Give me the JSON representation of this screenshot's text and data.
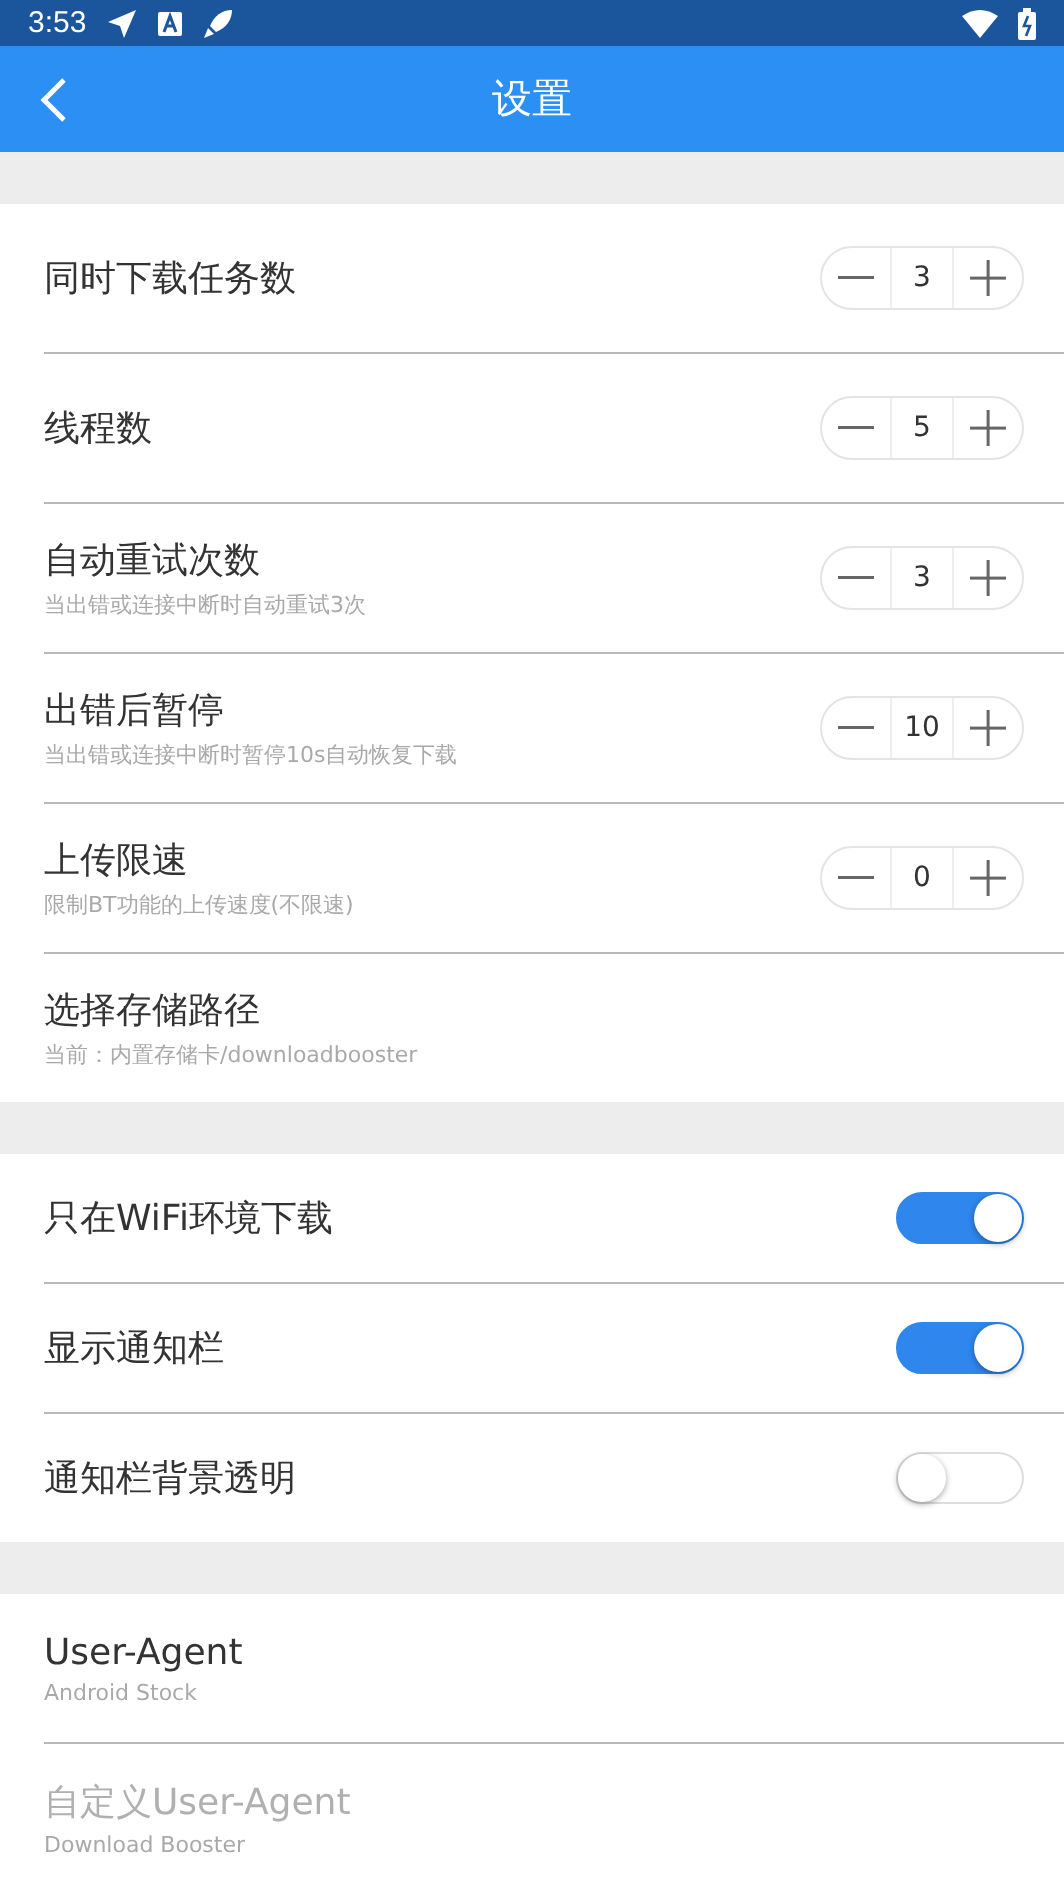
{
  "status_bar": {
    "time": "3:53"
  },
  "app_bar": {
    "title": "设置"
  },
  "sections": [
    {
      "rows": [
        {
          "kind": "stepper",
          "title": "同时下载任务数",
          "value": "3",
          "disabled": false
        },
        {
          "kind": "stepper",
          "title": "线程数",
          "value": "5",
          "disabled": false
        },
        {
          "kind": "stepper",
          "title": "自动重试次数",
          "subtitle": "当出错或连接中断时自动重试3次",
          "value": "3",
          "disabled": false
        },
        {
          "kind": "stepper",
          "title": "出错后暂停",
          "subtitle": "当出错或连接中断时暂停10s自动恢复下载",
          "value": "10",
          "disabled": false
        },
        {
          "kind": "stepper",
          "title": "上传限速",
          "subtitle": "限制BT功能的上传速度(不限速)",
          "value": "0",
          "disabled": false
        },
        {
          "kind": "link",
          "title": "选择存储路径",
          "subtitle": "当前：内置存储卡/downloadbooster",
          "disabled": false
        }
      ]
    },
    {
      "rows": [
        {
          "kind": "toggle",
          "title": "只在WiFi环境下载",
          "on": true,
          "disabled": false
        },
        {
          "kind": "toggle",
          "title": "显示通知栏",
          "on": true,
          "disabled": false
        },
        {
          "kind": "toggle",
          "title": "通知栏背景透明",
          "on": false,
          "disabled": false
        }
      ]
    },
    {
      "rows": [
        {
          "kind": "link",
          "title": "User-Agent",
          "subtitle": "Android Stock",
          "disabled": false
        },
        {
          "kind": "link",
          "title": "自定义User-Agent",
          "subtitle": "Download Booster",
          "disabled": true
        }
      ]
    }
  ]
}
